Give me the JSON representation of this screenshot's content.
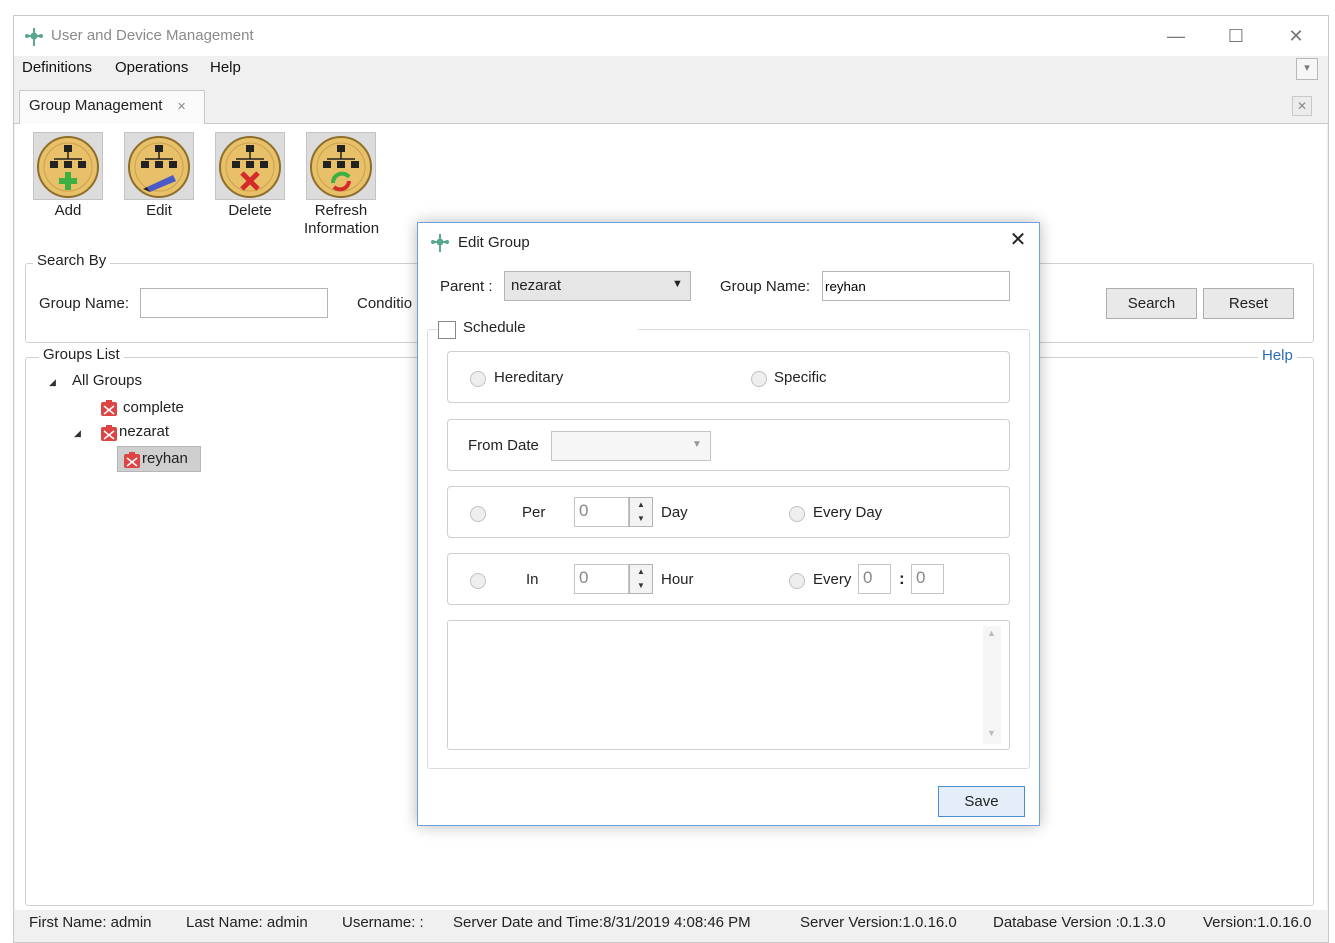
{
  "window": {
    "title": "User and Device Management"
  },
  "menu": {
    "items": [
      "Definitions",
      "Operations",
      "Help"
    ]
  },
  "tabs": [
    {
      "label": "Group Management"
    }
  ],
  "toolbar": {
    "add_label": "Add",
    "edit_label": "Edit",
    "delete_label": "Delete",
    "refresh_label_line1": "Refresh",
    "refresh_label_line2": "Information"
  },
  "search": {
    "title": "Search By",
    "group_name_label": "Group Name:",
    "group_name_value": "",
    "condition_label": "Conditio",
    "search_button": "Search",
    "reset_button": "Reset"
  },
  "groups_list": {
    "title": "Groups List",
    "help_link": "Help",
    "root": "All Groups",
    "items": [
      {
        "label": "complete",
        "level": 1
      },
      {
        "label": "nezarat",
        "level": 1
      },
      {
        "label": "reyhan",
        "level": 2,
        "selected": true
      }
    ]
  },
  "status_bar": {
    "first_name": "First Name: admin",
    "last_name": "Last Name: admin",
    "username": "Username: :",
    "server_datetime": "Server Date and Time:8/31/2019 4:08:46 PM",
    "server_version": "Server Version:1.0.16.0",
    "database_version": "Database Version :0.1.3.0",
    "version": "Version:1.0.16.0"
  },
  "dialog": {
    "title": "Edit Group",
    "parent_label": "Parent :",
    "parent_value": "nezarat",
    "group_name_label": "Group Name:",
    "group_name_value": "reyhan",
    "schedule_label": "Schedule",
    "schedule_checked": false,
    "hereditary_label": "Hereditary",
    "specific_label": "Specific",
    "from_date_label": "From Date",
    "from_date_value": "",
    "per_label": "Per",
    "per_value": "0",
    "day_label": "Day",
    "every_day_label": "Every Day",
    "in_label": "In",
    "in_value": "0",
    "hour_label": "Hour",
    "every_label": "Every",
    "every_hour_value": "0",
    "time_separator": ":",
    "every_minute_value": "0",
    "notes_value": "",
    "save_button": "Save"
  },
  "colors": {
    "dialog_border": "#6fa3d8",
    "help_link": "#2b6cb5",
    "selected_item_bg": "#cfcfcf",
    "icon_gold": "#e8c06a"
  },
  "icons": {
    "app": "network-icon",
    "add": "group-add-icon",
    "edit": "group-edit-icon",
    "delete": "group-delete-icon",
    "refresh": "group-refresh-icon",
    "tree_node": "group-node-icon"
  }
}
